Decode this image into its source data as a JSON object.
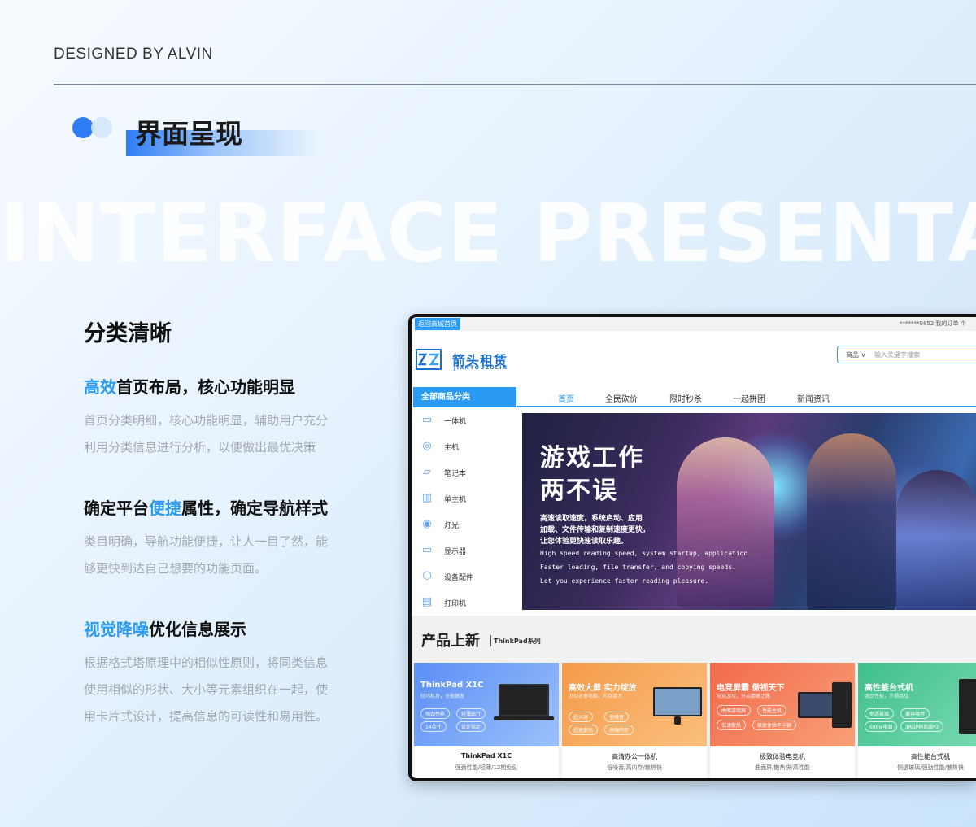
{
  "header": {
    "designed_by": "DESIGNED BY ALVIN",
    "section_title": "界面呈现",
    "bg_text": "INTERFACE PRESENTATION"
  },
  "left": {
    "heading": "分类清晰",
    "sections": [
      {
        "h_pre": "",
        "h_hl": "高效",
        "h_post": "首页布局，核心功能明显",
        "p1": "首页分类明细，核心功能明显，辅助用户充分",
        "p2": "利用分类信息进行分析，以便做出最优决策"
      },
      {
        "h_pre": "确定平台",
        "h_hl": "便捷",
        "h_post": "属性，确定导航样式",
        "p1": "类目明确，导航功能便捷，让人一目了然，能",
        "p2": "够更快到达自己想要的功能页面。"
      },
      {
        "h_pre": "",
        "h_hl": "视觉降噪",
        "h_post": "优化信息展示",
        "p1": "根据格式塔原理中的相似性原则，将同类信息",
        "p2": "使用相似的形状、大小等元素组织在一起，使",
        "p3": "用卡片式设计，提高信息的可读性和易用性。"
      }
    ]
  },
  "site": {
    "top_button": "返回商城首页",
    "top_right": "*******9852   我的订单   个",
    "brand": "箭头租赁",
    "brand_sub": "JIANTOUZULIN",
    "search_category": "商品 ∨",
    "search_placeholder": "输入关键字搜索",
    "all_categories": "全部商品分类",
    "nav": [
      "首页",
      "全民砍价",
      "限时秒杀",
      "一起拼团",
      "新闻资讯"
    ],
    "sidebar": [
      {
        "label": "一体机",
        "icon": "all-in-one-icon",
        "glyph": "▭"
      },
      {
        "label": "主机",
        "icon": "host-icon",
        "glyph": "◎"
      },
      {
        "label": "笔记本",
        "icon": "laptop-icon",
        "glyph": "▱"
      },
      {
        "label": "单主机",
        "icon": "tower-icon",
        "glyph": "▥"
      },
      {
        "label": "灯光",
        "icon": "camera-icon",
        "glyph": "◉"
      },
      {
        "label": "显示器",
        "icon": "monitor-icon",
        "glyph": "▭"
      },
      {
        "label": "设备配件",
        "icon": "accessory-icon",
        "glyph": "⬡"
      },
      {
        "label": "打印机",
        "icon": "printer-icon",
        "glyph": "▤"
      }
    ],
    "banner": {
      "title1": "游戏工作",
      "title2": "两不误",
      "cn1": "高速读取速度，系统启动、应用",
      "cn2": "加载、文件传输和复制速度更快，",
      "cn3": "让您体验更快速读取乐趣。",
      "en1": "High speed reading speed, system startup, application",
      "en2": "Faster loading, file transfer, and copying speeds.",
      "en3": "Let you experience faster reading pleasure."
    },
    "new_title": "产品上新",
    "new_sub": "ThinkPad系列",
    "cards": [
      {
        "title": "ThinkPad X1C",
        "sub": "轻巧机身，全能触发",
        "tags": [
          "强劲性能",
          "轻薄出行",
          "14英寸",
          "设定指定"
        ],
        "name": "ThinkPad X1C",
        "desc": "强劲性能/轻薄/12期免息",
        "color1": "#5b8ef5",
        "color2": "#9cc1fb"
      },
      {
        "title": "高效大屏 实力绽放",
        "sub": "办公必备电脑，内存增大",
        "tags": [
          "超大屏",
          "低噪音",
          "超速散热",
          "高端内存"
        ],
        "name": "高清办公一体机",
        "desc": "低噪音/高内存/散热快",
        "color1": "#f59a4a",
        "color2": "#fbc07d"
      },
      {
        "title": "电竞屏霸 傲视天下",
        "sub": "电竞游戏，开启巅峰之路",
        "tags": [
          "曲面游戏屏",
          "性能主机",
          "低速散热",
          "极致体验不卡顿"
        ],
        "name": "极致体验电竞机",
        "desc": "曲面屏/散热快/高性能",
        "color1": "#f26a4b",
        "color2": "#f8a077"
      },
      {
        "title": "高性能台式机",
        "sub": "强劲性能，不惧挑战",
        "tags": [
          "侧透玻璃",
          "兼容强悍",
          "600w电源",
          "3RGP神风扇*3"
        ],
        "name": "高性能台式机",
        "desc": "侧透玻璃/强劲性能/散热快",
        "color1": "#3fbf8a",
        "color2": "#7ddcb4"
      }
    ]
  }
}
